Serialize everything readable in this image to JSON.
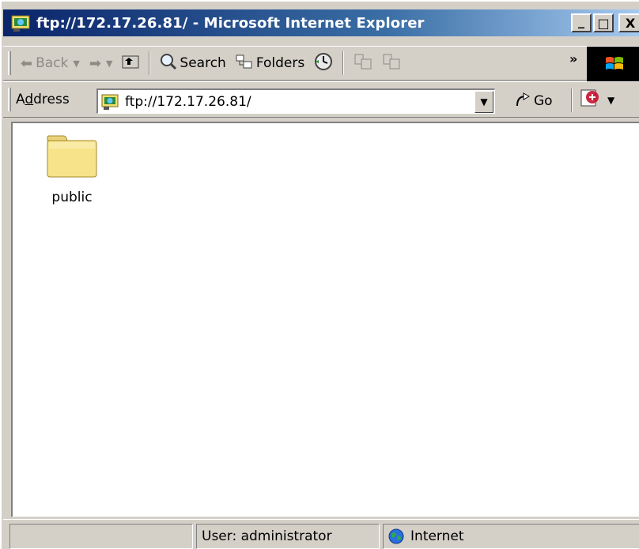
{
  "window": {
    "title": "ftp://172.17.26.81/ - Microsoft Internet Explorer",
    "minimize_label": "_",
    "maximize_label": "□",
    "close_label": "X"
  },
  "toolbar": {
    "back_label": "Back",
    "search_label": "Search",
    "folders_label": "Folders",
    "chevron_label": "»"
  },
  "address_bar": {
    "label_prefix": "A",
    "label_accel": "d",
    "label_suffix": "dress",
    "value": "ftp://172.17.26.81/",
    "go_label": "Go"
  },
  "content": {
    "items": [
      {
        "name": "public",
        "type": "folder"
      }
    ]
  },
  "statusbar": {
    "user_text": "User: administrator",
    "zone_text": "Internet"
  },
  "colors": {
    "titlebar_start": "#0a246a",
    "titlebar_end": "#a6caf0",
    "chrome": "#d4d0c8",
    "folder": "#f7e48a"
  }
}
